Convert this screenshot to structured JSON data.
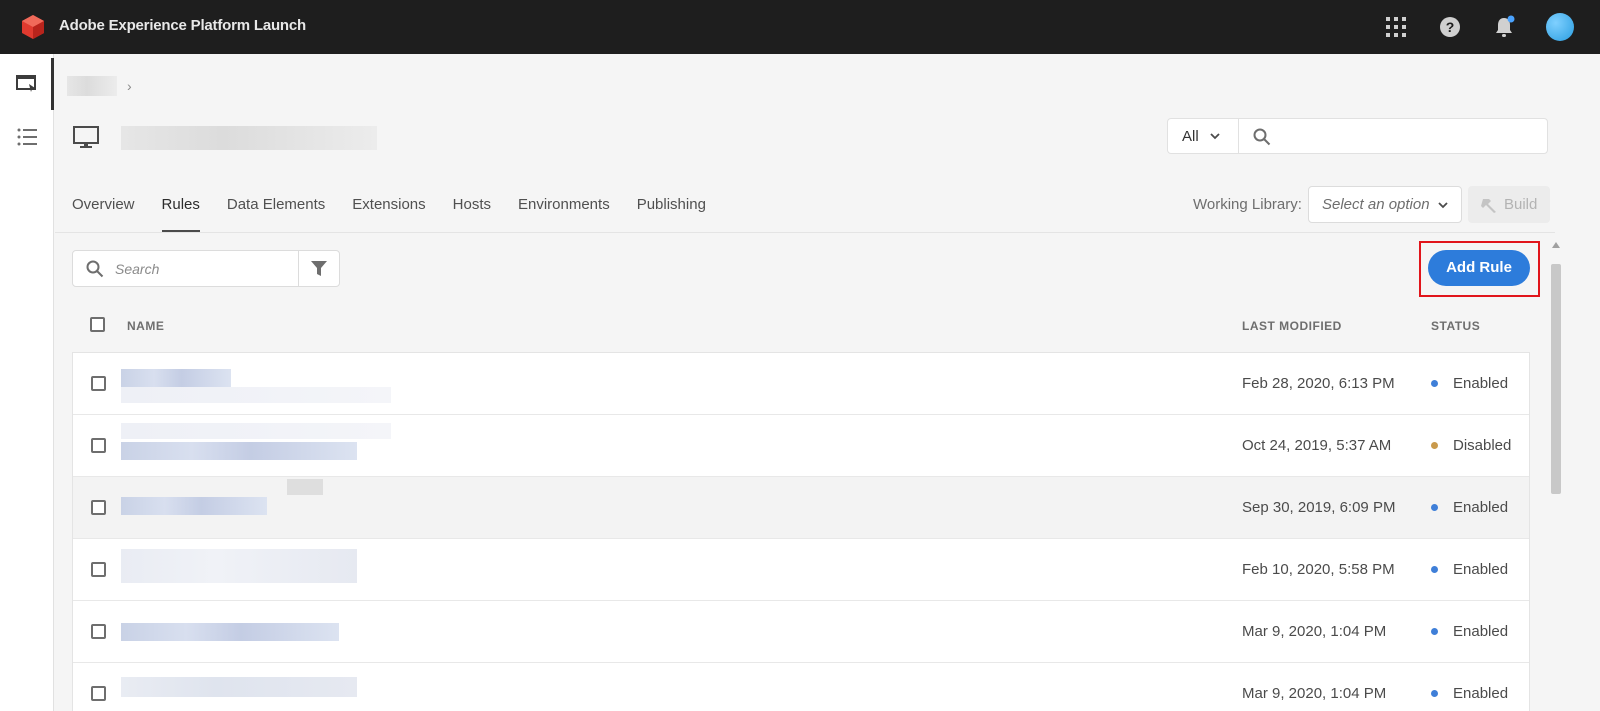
{
  "app": {
    "title": "Adobe Experience Platform Launch"
  },
  "colors": {
    "accent": "#2d7cdb",
    "enabled": "#3f7fd8",
    "disabled": "#c99a4c",
    "highlight": "#e1151b"
  },
  "header": {
    "scope_select": "All",
    "search_placeholder": ""
  },
  "tabs": [
    {
      "label": "Overview"
    },
    {
      "label": "Rules"
    },
    {
      "label": "Data Elements"
    },
    {
      "label": "Extensions"
    },
    {
      "label": "Hosts"
    },
    {
      "label": "Environments"
    },
    {
      "label": "Publishing"
    }
  ],
  "library": {
    "label": "Working Library:",
    "placeholder": "Select an option",
    "build_label": "Build"
  },
  "list": {
    "search_placeholder": "Search",
    "add_button": "Add Rule",
    "columns": {
      "name": "NAME",
      "modified": "LAST MODIFIED",
      "status": "STATUS"
    },
    "rows": [
      {
        "modified": "Feb 28, 2020, 6:13 PM",
        "status": "Enabled"
      },
      {
        "modified": "Oct 24, 2019, 5:37 AM",
        "status": "Disabled"
      },
      {
        "modified": "Sep 30, 2019, 6:09 PM",
        "status": "Enabled"
      },
      {
        "modified": "Feb 10, 2020, 5:58 PM",
        "status": "Enabled"
      },
      {
        "modified": "Mar 9, 2020, 1:04 PM",
        "status": "Enabled"
      },
      {
        "modified": "Mar 9, 2020, 1:04 PM",
        "status": "Enabled"
      }
    ]
  }
}
